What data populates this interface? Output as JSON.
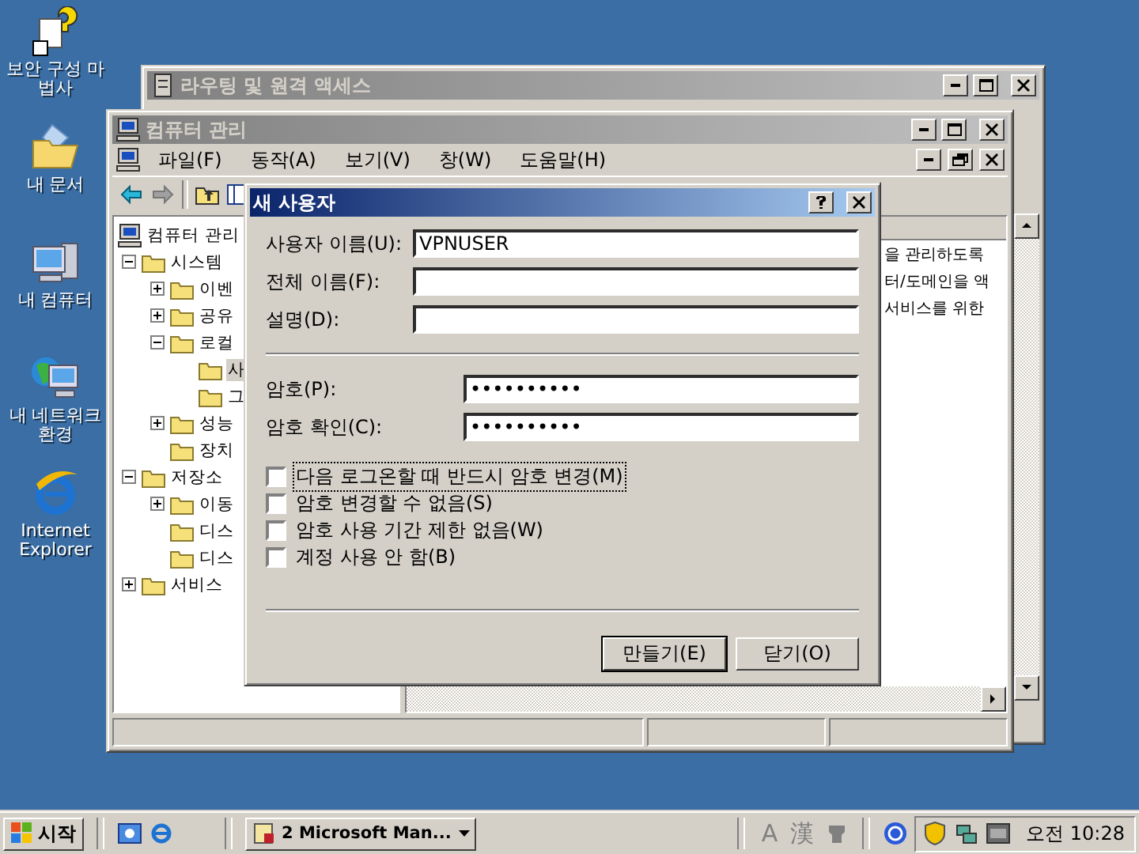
{
  "desktop_icons": [
    {
      "kind": "wizard",
      "label": "보안 구성 마법사"
    },
    {
      "kind": "documents",
      "label": "내 문서"
    },
    {
      "kind": "computer",
      "label": "내 컴퓨터"
    },
    {
      "kind": "network",
      "label": "내 네트워크 환경"
    },
    {
      "kind": "browser",
      "label": "Internet Explorer"
    }
  ],
  "back_window": {
    "title": "라우팅 및 원격 액세스",
    "active": false
  },
  "main_window": {
    "title": "컴퓨터 관리",
    "active": false,
    "menu": [
      "파일(F)",
      "동작(A)",
      "보기(V)",
      "창(W)",
      "도움말(H)"
    ],
    "tree": [
      {
        "label": "컴퓨터 관리",
        "selected": false,
        "children": [
          {
            "label": "시스템",
            "selected": false,
            "expanded": true,
            "children": [
              {
                "label": "이벤",
                "selected": false,
                "expanded": false
              },
              {
                "label": "공유",
                "selected": false,
                "expanded": false
              },
              {
                "label": "로컬",
                "selected": false,
                "expanded": true,
                "children": [
                  {
                    "label": "사",
                    "selected": true
                  },
                  {
                    "label": "그",
                    "selected": false
                  }
                ]
              },
              {
                "label": "성능",
                "selected": false,
                "expanded": false
              },
              {
                "label": "장치",
                "selected": false
              }
            ]
          },
          {
            "label": "저장소",
            "selected": false,
            "expanded": true,
            "children": [
              {
                "label": "이동",
                "selected": false,
                "expanded": false
              },
              {
                "label": "디스",
                "selected": false
              },
              {
                "label": "디스",
                "selected": false
              }
            ]
          },
          {
            "label": "서비스",
            "selected": false,
            "expanded": false
          }
        ]
      }
    ],
    "details_lines": [
      "을 관리하도록",
      "터/도메인을 액",
      "서비스를 위한"
    ]
  },
  "dialog": {
    "title": "새 사용자",
    "active": true,
    "fields": [
      {
        "label": "사용자 이름(U):",
        "value": "VPNUSER"
      },
      {
        "label": "전체 이름(F):"
      },
      {
        "label": "설명(D):"
      }
    ],
    "password_fields": [
      {
        "label": "암호(P):",
        "value": "••••••••••"
      },
      {
        "label": "암호 확인(C):",
        "value": "••••••••••"
      }
    ],
    "options": [
      {
        "label": "다음 로그온할 때 반드시 암호 변경(M)",
        "checked": false,
        "focused": true
      },
      {
        "label": "암호 변경할 수 없음(S)",
        "checked": false,
        "focused": false
      },
      {
        "label": "암호 사용 기간 제한 없음(W)",
        "checked": false,
        "focused": false
      },
      {
        "label": "계정 사용 안 함(B)",
        "checked": false,
        "focused": false
      }
    ],
    "buttons": [
      "만들기(E)",
      "닫기(O)"
    ]
  },
  "taskbar": {
    "start": "시작",
    "task": "2 Microsoft Man...",
    "language": [
      "A",
      "漢"
    ],
    "clock": "오전 10:28"
  }
}
